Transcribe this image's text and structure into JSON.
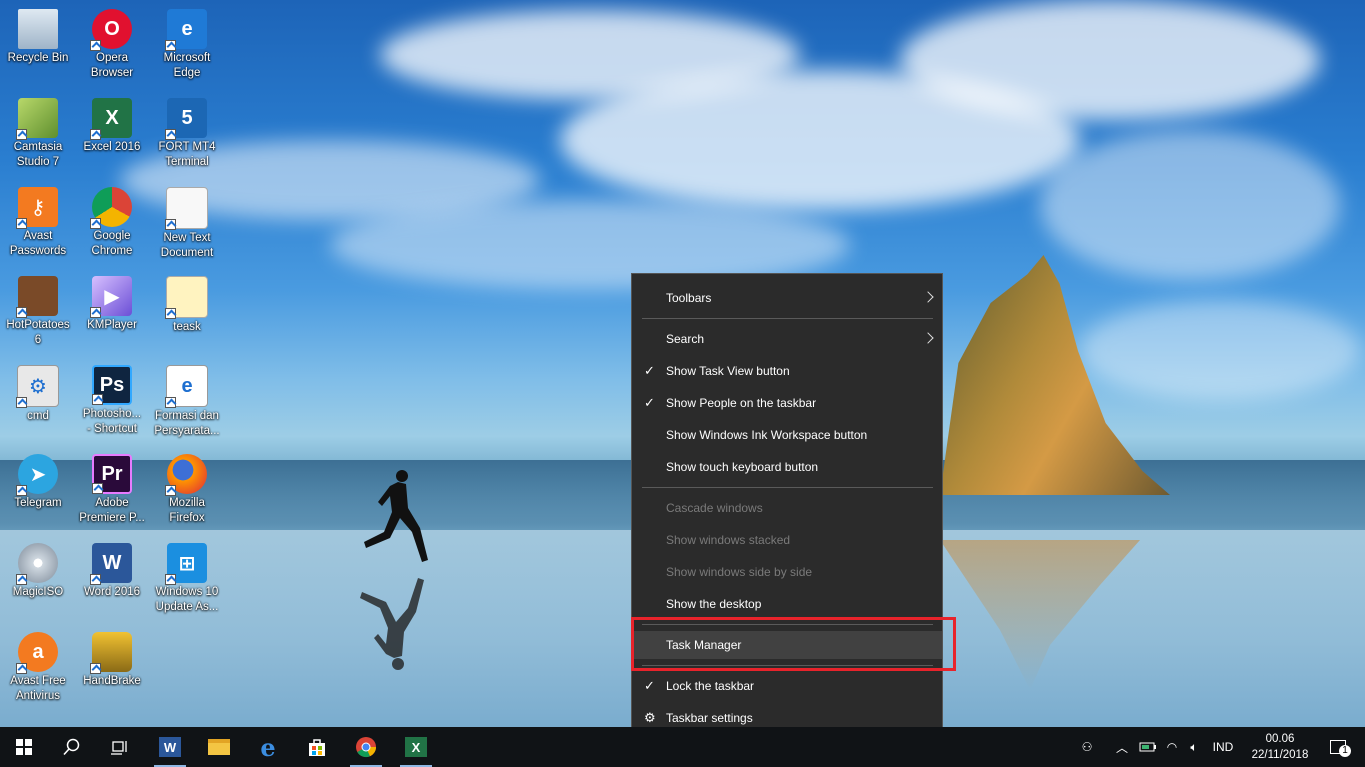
{
  "desktop_icons": [
    {
      "label": "Recycle Bin",
      "icon": "recycle-bin-icon"
    },
    {
      "label": "Opera\nBrowser",
      "icon": "opera-icon"
    },
    {
      "label": "Microsoft\nEdge",
      "icon": "edge-icon"
    },
    {
      "label": "Camtasia\nStudio 7",
      "icon": "camtasia-icon"
    },
    {
      "label": "Excel 2016",
      "icon": "excel-icon"
    },
    {
      "label": "FORT MT4\nTerminal",
      "icon": "mt4-icon"
    },
    {
      "label": "Avast\nPasswords",
      "icon": "avast-passwords-icon"
    },
    {
      "label": "Google\nChrome",
      "icon": "chrome-icon"
    },
    {
      "label": "New Text\nDocument",
      "icon": "text-document-icon"
    },
    {
      "label": "HotPotatoes\n6",
      "icon": "hotpotatoes-icon"
    },
    {
      "label": "KMPlayer",
      "icon": "kmplayer-icon"
    },
    {
      "label": "teask",
      "icon": "file-icon"
    },
    {
      "label": "cmd",
      "icon": "cmd-icon"
    },
    {
      "label": "Photosho...\n- Shortcut",
      "icon": "photoshop-icon"
    },
    {
      "label": "Formasi dan\nPersyarata...",
      "icon": "pdf-icon"
    },
    {
      "label": "Telegram",
      "icon": "telegram-icon"
    },
    {
      "label": "Adobe\nPremiere P...",
      "icon": "premiere-icon"
    },
    {
      "label": "Mozilla\nFirefox",
      "icon": "firefox-icon"
    },
    {
      "label": "MagicISO",
      "icon": "magiciso-icon"
    },
    {
      "label": "Word 2016",
      "icon": "word-icon"
    },
    {
      "label": "Windows 10\nUpdate As...",
      "icon": "windows-update-icon"
    },
    {
      "label": "Avast Free\nAntivirus",
      "icon": "avast-icon"
    },
    {
      "label": "HandBrake",
      "icon": "handbrake-icon"
    }
  ],
  "context_menu": {
    "items": [
      {
        "label": "Toolbars",
        "submenu": true
      },
      {
        "label": "Search",
        "submenu": true
      },
      {
        "label": "Show Task View button",
        "checked": true
      },
      {
        "label": "Show People on the taskbar",
        "checked": true
      },
      {
        "label": "Show Windows Ink Workspace button"
      },
      {
        "label": "Show touch keyboard button"
      },
      {
        "label": "Cascade windows",
        "disabled": true
      },
      {
        "label": "Show windows stacked",
        "disabled": true
      },
      {
        "label": "Show windows side by side",
        "disabled": true
      },
      {
        "label": "Show the desktop"
      },
      {
        "label": "Task Manager",
        "highlighted": true
      },
      {
        "label": "Lock the taskbar",
        "checked": true
      },
      {
        "label": "Taskbar settings",
        "icon": "gear-icon"
      }
    ],
    "check_glyph": "✓",
    "highlight_color": "#e8232b"
  },
  "taskbar": {
    "pinned": [
      "start-icon",
      "search-icon",
      "task-view-icon",
      "word-icon",
      "file-explorer-icon",
      "edge-icon",
      "store-icon",
      "chrome-icon",
      "excel-icon"
    ],
    "tray": {
      "language": "IND",
      "time": "00.06",
      "date": "22/11/2018",
      "notification_count": "1"
    }
  }
}
